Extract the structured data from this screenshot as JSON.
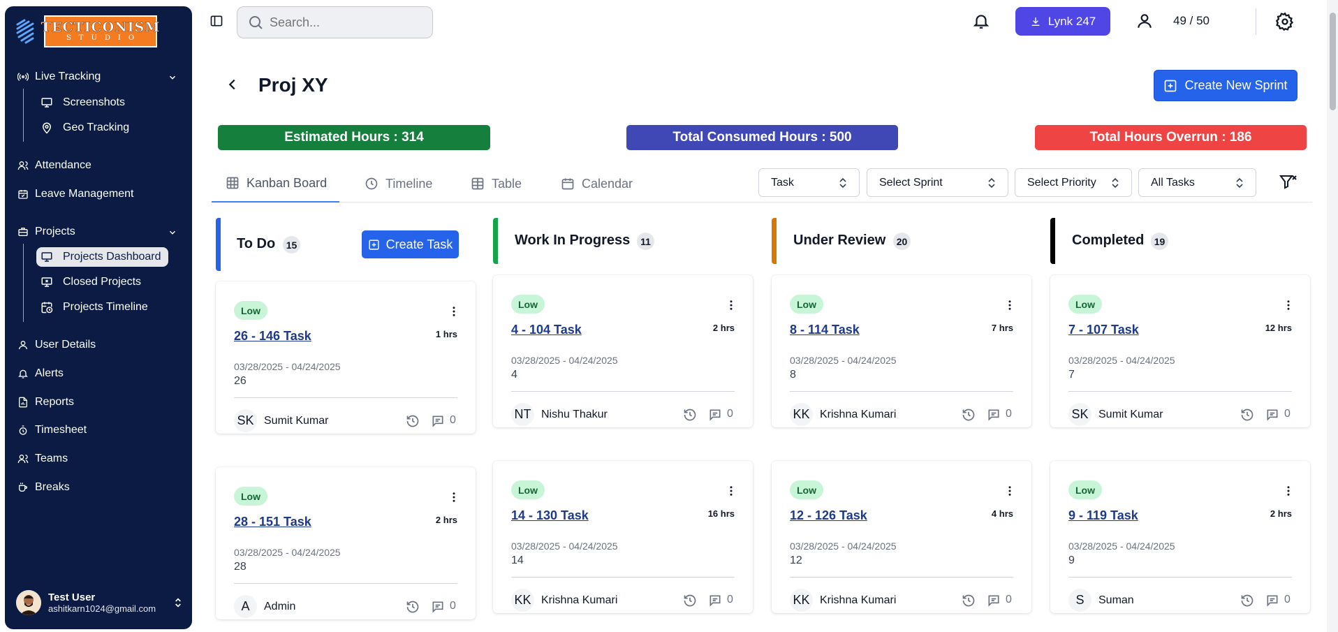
{
  "brand": {
    "line1": "TECTICONISM",
    "line2": "STUDIO"
  },
  "sidebar": {
    "live_tracking": "Live Tracking",
    "screenshots": "Screenshots",
    "geo_tracking": "Geo Tracking",
    "attendance": "Attendance",
    "leave_management": "Leave Management",
    "projects": "Projects",
    "projects_dashboard": "Projects Dashboard",
    "closed_projects": "Closed Projects",
    "projects_timeline": "Projects Timeline",
    "user_details": "User Details",
    "alerts": "Alerts",
    "reports": "Reports",
    "timesheet": "Timesheet",
    "teams": "Teams",
    "breaks": "Breaks"
  },
  "user": {
    "name": "Test User",
    "email": "ashitkarn1024@gmail.com"
  },
  "topbar": {
    "search_placeholder": "Search...",
    "lynk_label": "Lynk 247",
    "user_count": "49 / 50"
  },
  "page": {
    "title": "Proj XY",
    "create_sprint_label": "Create New Sprint",
    "estimated_hours": "Estimated Hours : 314",
    "consumed_hours": "Total Consumed Hours : 500",
    "overrun_hours": "Total Hours Overrun : 186"
  },
  "tabs": [
    "Kanban Board",
    "Timeline",
    "Table",
    "Calendar"
  ],
  "filters": {
    "type": "Task",
    "sprint": "Select Sprint",
    "priority": "Select Priority",
    "scope": "All Tasks"
  },
  "colors": {
    "sidebar_bg": "#0b1b43",
    "estimated": "#15803d",
    "consumed": "#3f48b4",
    "overrun": "#ef4444",
    "todo": "#2563eb",
    "wip": "#16a34a",
    "review": "#d97706",
    "completed": "#000000"
  },
  "create_task_label": "Create Task",
  "columns": [
    {
      "title": "To Do",
      "count": "15",
      "cards": [
        {
          "priority": "Low",
          "title": "26 - 146 Task",
          "hours": "1 hrs",
          "dates": "03/28/2025 - 04/24/2025",
          "num": "26",
          "initials": "SK",
          "assignee": "Sumit Kumar",
          "comments": "0"
        },
        {
          "priority": "Low",
          "title": "28 - 151 Task",
          "hours": "2 hrs",
          "dates": "03/28/2025 - 04/24/2025",
          "num": "28",
          "initials": "A",
          "assignee": "Admin",
          "comments": "0"
        }
      ]
    },
    {
      "title": "Work In Progress",
      "count": "11",
      "cards": [
        {
          "priority": "Low",
          "title": "4 - 104 Task",
          "hours": "2 hrs",
          "dates": "03/28/2025 - 04/24/2025",
          "num": "4",
          "initials": "NT",
          "assignee": "Nishu Thakur",
          "comments": "0"
        },
        {
          "priority": "Low",
          "title": "14 - 130 Task",
          "hours": "16 hrs",
          "dates": "03/28/2025 - 04/24/2025",
          "num": "14",
          "initials": "KK",
          "assignee": "Krishna Kumari",
          "comments": "0"
        }
      ]
    },
    {
      "title": "Under Review",
      "count": "20",
      "cards": [
        {
          "priority": "Low",
          "title": "8 - 114 Task",
          "hours": "7 hrs",
          "dates": "03/28/2025 - 04/24/2025",
          "num": "8",
          "initials": "KK",
          "assignee": "Krishna Kumari",
          "comments": "0"
        },
        {
          "priority": "Low",
          "title": "12 - 126 Task",
          "hours": "4 hrs",
          "dates": "03/28/2025 - 04/24/2025",
          "num": "12",
          "initials": "KK",
          "assignee": "Krishna Kumari",
          "comments": "0"
        }
      ]
    },
    {
      "title": "Completed",
      "count": "19",
      "cards": [
        {
          "priority": "Low",
          "title": "7 - 107 Task",
          "hours": "12 hrs",
          "dates": "03/28/2025 - 04/24/2025",
          "num": "7",
          "initials": "SK",
          "assignee": "Sumit Kumar",
          "comments": "0"
        },
        {
          "priority": "Low",
          "title": "9 - 119 Task",
          "hours": "2 hrs",
          "dates": "03/28/2025 - 04/24/2025",
          "num": "9",
          "initials": "S",
          "assignee": "Suman",
          "comments": "0"
        }
      ]
    }
  ]
}
